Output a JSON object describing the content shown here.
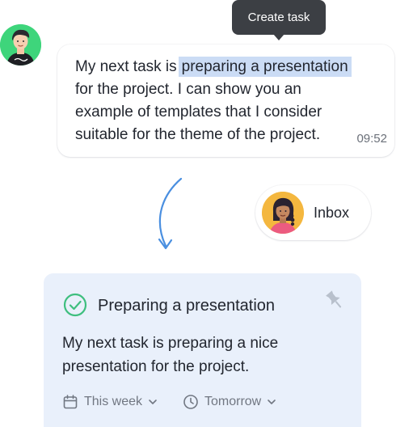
{
  "tooltip": {
    "label": "Create task"
  },
  "message": {
    "line1_before": "My next task is",
    "line1_highlight": "preparing a presentation",
    "line2": "for the project. I can show you an",
    "line3": "example of templates that I consider",
    "line4": "suitable for the theme of the project.",
    "time": "09:52"
  },
  "inbox": {
    "label": "Inbox"
  },
  "task": {
    "title": "Preparing a presentation",
    "desc_line1": "My next task is preparing a nice",
    "desc_line2": "presentation for the project.",
    "due_label": "This week",
    "reminder_label": "Tomorrow"
  },
  "colors": {
    "highlight": "#cbdcf5",
    "card_background": "#e9f0fb",
    "check_green": "#3fbf7f",
    "arrow_blue": "#4a8fe0",
    "tooltip_background": "#3c3f44"
  },
  "icons": {
    "check": "check-circle-icon",
    "pin": "pin-icon",
    "calendar": "calendar-icon",
    "clock": "clock-icon",
    "chevron": "chevron-down-icon",
    "arrow": "curved-arrow-down-icon"
  }
}
